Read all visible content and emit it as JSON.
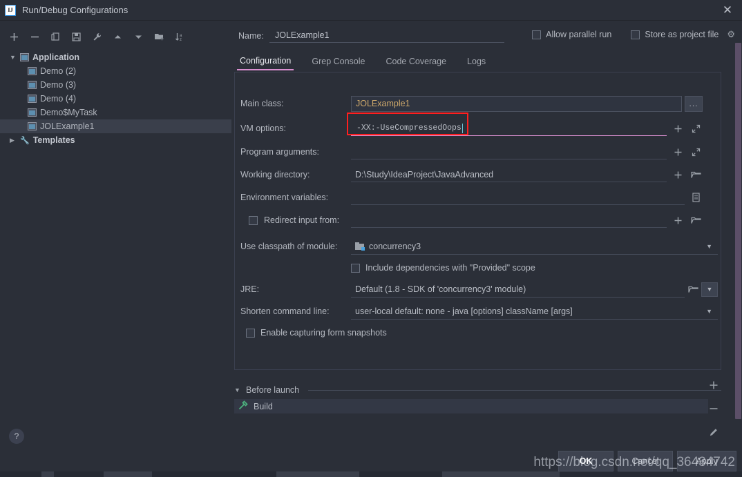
{
  "window": {
    "title": "Run/Debug Configurations",
    "app_icon": "intellij-idea-icon",
    "close_label": "✕"
  },
  "sidebar": {
    "toolbar": [
      {
        "name": "add-configuration-button",
        "icon": "plus-icon"
      },
      {
        "name": "remove-configuration-button",
        "icon": "minus-icon"
      },
      {
        "name": "copy-configuration-button",
        "icon": "copy-icon"
      },
      {
        "name": "save-configuration-button",
        "icon": "save-icon"
      },
      {
        "name": "edit-templates-button",
        "icon": "wrench-icon"
      },
      {
        "name": "move-up-button",
        "icon": "arrow-up-icon"
      },
      {
        "name": "move-down-button",
        "icon": "arrow-down-icon"
      },
      {
        "name": "new-folder-button",
        "icon": "folder-add-icon"
      },
      {
        "name": "sort-configurations-button",
        "icon": "sort-az-icon"
      }
    ],
    "tree": [
      {
        "label": "Application",
        "level": 0,
        "expanded": true,
        "bold": true,
        "icon": "application-icon",
        "selected": false
      },
      {
        "label": "Demo (2)",
        "level": 1,
        "expanded": null,
        "bold": false,
        "icon": "run-config-icon",
        "selected": false
      },
      {
        "label": "Demo (3)",
        "level": 1,
        "expanded": null,
        "bold": false,
        "icon": "run-config-icon",
        "selected": false
      },
      {
        "label": "Demo (4)",
        "level": 1,
        "expanded": null,
        "bold": false,
        "icon": "run-config-icon",
        "selected": false
      },
      {
        "label": "Demo$MyTask",
        "level": 1,
        "expanded": null,
        "bold": false,
        "icon": "run-config-icon",
        "selected": false
      },
      {
        "label": "JOLExample1",
        "level": 1,
        "expanded": null,
        "bold": false,
        "icon": "run-config-icon",
        "selected": true
      },
      {
        "label": "Templates",
        "level": 0,
        "expanded": false,
        "bold": true,
        "icon": "wrench-icon",
        "selected": false
      }
    ],
    "help_label": "?"
  },
  "form": {
    "name_label": "Name:",
    "name_value": "JOLExample1",
    "allow_parallel_run": "Allow parallel run",
    "store_as_project_file": "Store as project file",
    "settings_gear": "gear-icon",
    "tabs": [
      {
        "label": "Configuration",
        "active": true
      },
      {
        "label": "Grep Console",
        "active": false
      },
      {
        "label": "Code Coverage",
        "active": false
      },
      {
        "label": "Logs",
        "active": false
      }
    ],
    "fields": {
      "main_class_label": "Main class:",
      "main_class_value": "JOLExample1",
      "main_class_browse": "...",
      "vm_options_label": "VM options:",
      "vm_options_value": "-XX:-UseCompressedOops",
      "program_arguments_label": "Program arguments:",
      "program_arguments_value": "",
      "working_directory_label": "Working directory:",
      "working_directory_value": "D:\\Study\\IdeaProject\\JavaAdvanced",
      "environment_variables_label": "Environment variables:",
      "environment_variables_value": "",
      "redirect_input_label": "Redirect input from:",
      "redirect_input_value": "",
      "use_classpath_label": "Use classpath of module:",
      "use_classpath_value": "concurrency3",
      "include_provided_label": "Include dependencies with \"Provided\" scope",
      "jre_label": "JRE:",
      "jre_value": "Default (1.8 - SDK of 'concurrency3' module)",
      "shorten_command_label": "Shorten command line:",
      "shorten_command_value": "user-local default: none - java [options] className [args]",
      "enable_snapshots_label": "Enable capturing form snapshots"
    }
  },
  "before_launch": {
    "header": "Before launch",
    "items": [
      {
        "label": "Build",
        "icon": "build-hammer-icon"
      }
    ],
    "actions": [
      {
        "name": "add-task-button",
        "icon": "plus-icon"
      },
      {
        "name": "remove-task-button",
        "icon": "minus-icon"
      },
      {
        "name": "edit-task-button",
        "icon": "pencil-icon"
      }
    ]
  },
  "buttons": {
    "ok": "OK",
    "cancel": "Cancel",
    "apply": "Apply"
  },
  "watermark": "https://blog.csdn.net/qq_36434742",
  "colors": {
    "background": "#2b2f38",
    "accent_pink": "#d98fd0",
    "highlight_red": "#ff1f1f",
    "value_orange": "#cfa96b",
    "scrollbar": "#5c4f68",
    "selection": "#3a3f4b"
  }
}
